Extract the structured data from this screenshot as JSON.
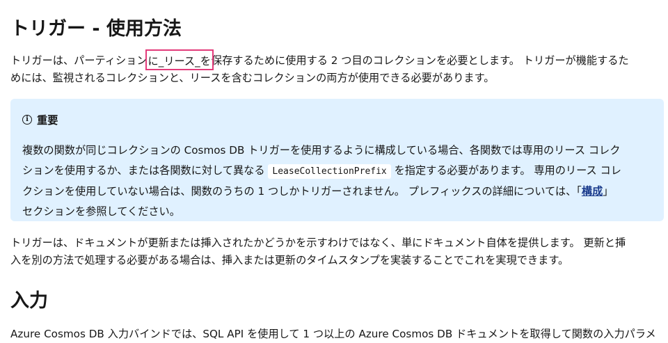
{
  "heading_main": "トリガー - 使用方法",
  "para1": {
    "line1_before": "トリガーは、パーティション",
    "line1_highlight": "に_リース_を",
    "line1_after": "保存するために使用する 2 つ目のコレクションを必要とします。 トリガーが機能するた",
    "line2": "めには、監視されるコレクションと、リースを含むコレクションの両方が使用できる必要があります。"
  },
  "alert": {
    "icon": "info-icon",
    "title": "重要",
    "line1": "複数の関数が同じコレクションの Cosmos DB トリガーを使用するように構成している場合、各関数では専用のリース コレク",
    "line2_before": "ションを使用するか、または各関数に対して異なる",
    "code": "LeaseCollectionPrefix",
    "line2_after": "を指定する必要があります。 専用のリース コレ",
    "line3_before": "クションを使用していない場合は、関数のうちの 1 つしかトリガーされません。 プレフィックスの詳細については、「",
    "line3_link": "構成",
    "line3_after": "」",
    "line4": "セクションを参照してください。"
  },
  "para2": {
    "line1": "トリガーは、ドキュメントが更新または挿入されたかどうかを示すわけではなく、単にドキュメント自体を提供します。 更新と挿",
    "line2": "入を別の方法で処理する必要がある場合は、挿入または更新のタイムスタンプを実装することでこれを実現できます。"
  },
  "heading_input": "入力",
  "para3": {
    "line1": "Azure Cosmos DB 入力バインドでは、SQL API を使用して 1 つ以上の Azure Cosmos DB ドキュメントを取得して関数の入力パラメ"
  },
  "colors": {
    "text": "#171717",
    "alert_bg": "#e0f1ff",
    "highlight_border": "#e33b7a",
    "link": "#1a3b8c"
  }
}
